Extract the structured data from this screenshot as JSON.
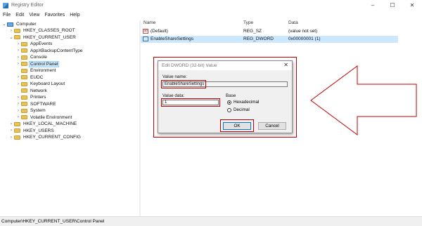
{
  "window": {
    "title": "Registry Editor",
    "minimize": "–",
    "maximize": "☐",
    "close": "✕"
  },
  "menu": [
    "File",
    "Edit",
    "View",
    "Favorites",
    "Help"
  ],
  "tree": {
    "root": "Computer",
    "items": [
      {
        "label": "HKEY_CLASSES_ROOT",
        "expanded": false
      },
      {
        "label": "HKEY_CURRENT_USER",
        "expanded": true
      },
      {
        "label": "AppEvents",
        "expanded": false
      },
      {
        "label": "AppXBackupContentType",
        "expanded": false
      },
      {
        "label": "Console",
        "expanded": false
      },
      {
        "label": "Control Panel",
        "expanded": false,
        "selected": true
      },
      {
        "label": "Environment",
        "expanded": false
      },
      {
        "label": "EUDC",
        "expanded": false
      },
      {
        "label": "Keyboard Layout",
        "expanded": false
      },
      {
        "label": "Network",
        "expanded": false
      },
      {
        "label": "Printers",
        "expanded": false
      },
      {
        "label": "SOFTWARE",
        "expanded": false
      },
      {
        "label": "System",
        "expanded": false
      },
      {
        "label": "Volatile Environment",
        "expanded": false
      },
      {
        "label": "HKEY_LOCAL_MACHINE",
        "expanded": false
      },
      {
        "label": "HKEY_USERS",
        "expanded": false
      },
      {
        "label": "HKEY_CURRENT_CONFIG",
        "expanded": false
      }
    ]
  },
  "values": {
    "columns": {
      "name": "Name",
      "type": "Type",
      "data": "Data"
    },
    "rows": [
      {
        "name": "(Default)",
        "type": "REG_SZ",
        "data": "(value not set)",
        "icon": "string-value-icon"
      },
      {
        "name": "EnableShareSettings",
        "type": "REG_DWORD",
        "data": "0x00000001 (1)",
        "icon": "binary-value-icon",
        "selected": true
      }
    ]
  },
  "dialog": {
    "title": "Edit DWORD (32-bit) Value",
    "close": "✕",
    "value_name_label": "Value name:",
    "value_name": "EnableShareSettings",
    "value_data_label": "Value data:",
    "value_data": "1",
    "base_label": "Base",
    "hex_label": "Hexadecimal",
    "dec_label": "Decimal",
    "base_selected": "Hexadecimal",
    "ok": "OK",
    "cancel": "Cancel"
  },
  "status": {
    "path": "Computer\\HKEY_CURRENT_USER\\Control Panel"
  },
  "colors": {
    "highlight": "#c00000",
    "selection": "#cce8ff"
  }
}
